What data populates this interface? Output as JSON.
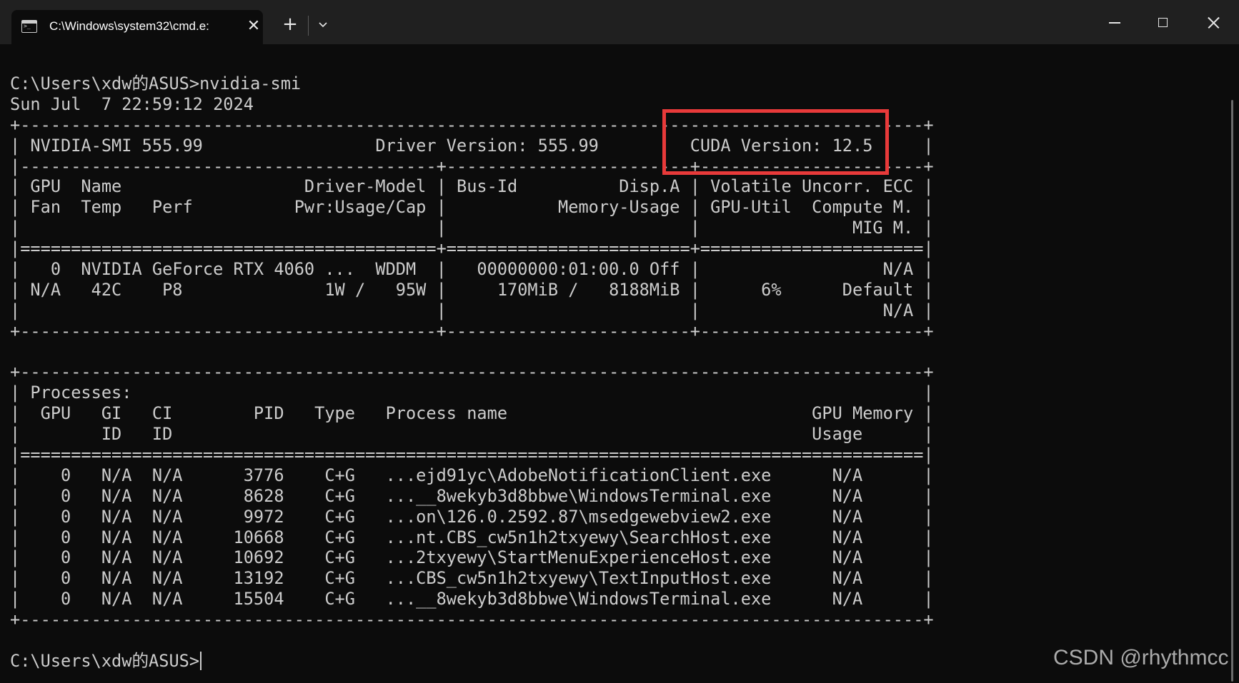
{
  "window": {
    "tab_title": "C:\\Windows\\system32\\cmd.e:",
    "tab_close_glyph": "✕",
    "new_tab_glyph": "+",
    "icons": [
      "cmd-icon",
      "close-icon",
      "plus-icon",
      "chevron-down-icon",
      "minimize-icon",
      "maximize-icon",
      "close-window-icon"
    ]
  },
  "terminal": {
    "lines": [
      "C:\\Users\\xdw的ASUS>nvidia-smi",
      "Sun Jul  7 22:59:12 2024",
      "+-----------------------------------------------------------------------------------------+",
      "| NVIDIA-SMI 555.99                 Driver Version: 555.99         CUDA Version: 12.5     |",
      "|-----------------------------------------+------------------------+----------------------+",
      "| GPU  Name                  Driver-Model | Bus-Id          Disp.A | Volatile Uncorr. ECC |",
      "| Fan  Temp   Perf          Pwr:Usage/Cap |           Memory-Usage | GPU-Util  Compute M. |",
      "|                                         |                        |               MIG M. |",
      "|=========================================+========================+======================|",
      "|   0  NVIDIA GeForce RTX 4060 ...  WDDM  |   00000000:01:00.0 Off |                  N/A |",
      "| N/A   42C    P8              1W /   95W |     170MiB /   8188MiB |      6%      Default |",
      "|                                         |                        |                  N/A |",
      "+-----------------------------------------+------------------------+----------------------+",
      "",
      "+-----------------------------------------------------------------------------------------+",
      "| Processes:                                                                              |",
      "|  GPU   GI   CI        PID   Type   Process name                              GPU Memory |",
      "|        ID   ID                                                               Usage      |",
      "|=========================================================================================|",
      "|    0   N/A  N/A      3776    C+G   ...ejd91yc\\AdobeNotificationClient.exe      N/A      |",
      "|    0   N/A  N/A      8628    C+G   ...__8wekyb3d8bbwe\\WindowsTerminal.exe      N/A      |",
      "|    0   N/A  N/A      9972    C+G   ...on\\126.0.2592.87\\msedgewebview2.exe      N/A      |",
      "|    0   N/A  N/A     10668    C+G   ...nt.CBS_cw5n1h2txyewy\\SearchHost.exe      N/A      |",
      "|    0   N/A  N/A     10692    C+G   ...2txyewy\\StartMenuExperienceHost.exe      N/A      |",
      "|    0   N/A  N/A     13192    C+G   ...CBS_cw5n1h2txyewy\\TextInputHost.exe      N/A      |",
      "|    0   N/A  N/A     15504    C+G   ...__8wekyb3d8bbwe\\WindowsTerminal.exe      N/A      |",
      "+-----------------------------------------------------------------------------------------+",
      "",
      "C:\\Users\\xdw的ASUS>"
    ]
  },
  "annotation": {
    "highlight_color": "#e83a3a"
  },
  "watermark": "CSDN @rhythmcc"
}
